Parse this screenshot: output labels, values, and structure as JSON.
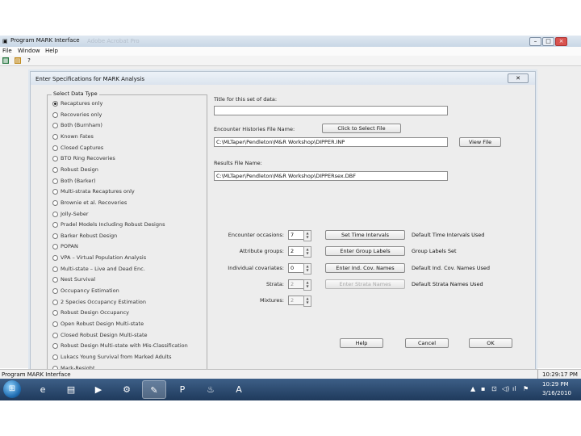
{
  "app": {
    "title": "Program MARK Interface",
    "faded_title": "Adobe Acrobat Pro",
    "menu": [
      "File",
      "Window",
      "Help"
    ],
    "window_buttons": [
      "–",
      "□",
      "×"
    ]
  },
  "dialog": {
    "title": "Enter Specifications for MARK Analysis",
    "close_label": "✕",
    "data_type": {
      "legend": "Select Data Type",
      "selected_index": 0,
      "options": [
        "Recaptures only",
        "Recoveries only",
        "Both (Burnham)",
        "Known Fates",
        "Closed Captures",
        "BTO Ring Recoveries",
        "Robust Design",
        "Both (Barker)",
        "Multi-strata Recaptures only",
        "Brownie et al. Recoveries",
        "Jolly-Seber",
        "Pradel Models Including Robust Designs",
        "Barker Robust Design",
        "POPAN",
        "VPA – Virtual Population Analysis",
        "Multi-state – Live and Dead Enc.",
        "Nest Survival",
        "Occupancy Estimation",
        "2 Species Occupancy Estimation",
        "Robust Design Occupancy",
        "Open Robust Design Multi-state",
        "Closed Robust Design Multi-state",
        "Robust Design Multi-state with Mis-Classification",
        "Lukacs Young Survival from Marked Adults",
        "Mark-Resight"
      ]
    },
    "title_field": {
      "label": "Title for this set of data:",
      "value": ""
    },
    "encounter_file": {
      "label": "Encounter Histories File Name:",
      "select_button": "Click to Select File",
      "value": "C:\\MLTaper\\Pendleton\\M&R Workshop\\DIPPER.INP",
      "view_button": "View File"
    },
    "results_file": {
      "label": "Results File Name:",
      "value": "C:\\MLTaper\\Pendleton\\M&R Workshop\\DIPPERsex.DBF"
    },
    "params": [
      {
        "label": "Encounter occasions:",
        "value": "7",
        "button": "Set Time Intervals",
        "note": "Default Time Intervals Used",
        "disabled": false
      },
      {
        "label": "Attribute groups:",
        "value": "2",
        "button": "Enter Group Labels",
        "note": "Group Labels Set",
        "disabled": false
      },
      {
        "label": "Individual covariates:",
        "value": "0",
        "button": "Enter Ind. Cov. Names",
        "note": "Default Ind. Cov. Names Used",
        "disabled": false
      },
      {
        "label": "Strata:",
        "value": "2",
        "button": "Enter Strata Names",
        "note": "Default Strata Names Used",
        "disabled": true
      },
      {
        "label": "Mixtures:",
        "value": "2",
        "button": "",
        "note": "",
        "disabled": true
      }
    ],
    "buttons": {
      "help": "Help",
      "cancel": "Cancel",
      "ok": "OK"
    }
  },
  "status": {
    "text": "Program MARK Interface",
    "time": "10:29:17 PM"
  },
  "taskbar": {
    "start": "⊞",
    "apps": [
      {
        "icon": "ie-icon",
        "glyph": "e"
      },
      {
        "icon": "folder-icon",
        "glyph": "▤"
      },
      {
        "icon": "media-player-icon",
        "glyph": "▶"
      },
      {
        "icon": "network-icon",
        "glyph": "⚙"
      },
      {
        "icon": "mark-program-icon",
        "glyph": "✎"
      },
      {
        "icon": "powerpoint-icon",
        "glyph": "P"
      },
      {
        "icon": "fire-icon",
        "glyph": "♨"
      },
      {
        "icon": "acrobat-icon",
        "glyph": "A"
      }
    ],
    "tray": [
      "▲",
      "▪",
      "⊡",
      "◁)",
      "ıl",
      "⚑"
    ],
    "clock_time": "10:29 PM",
    "clock_date": "3/16/2010"
  }
}
